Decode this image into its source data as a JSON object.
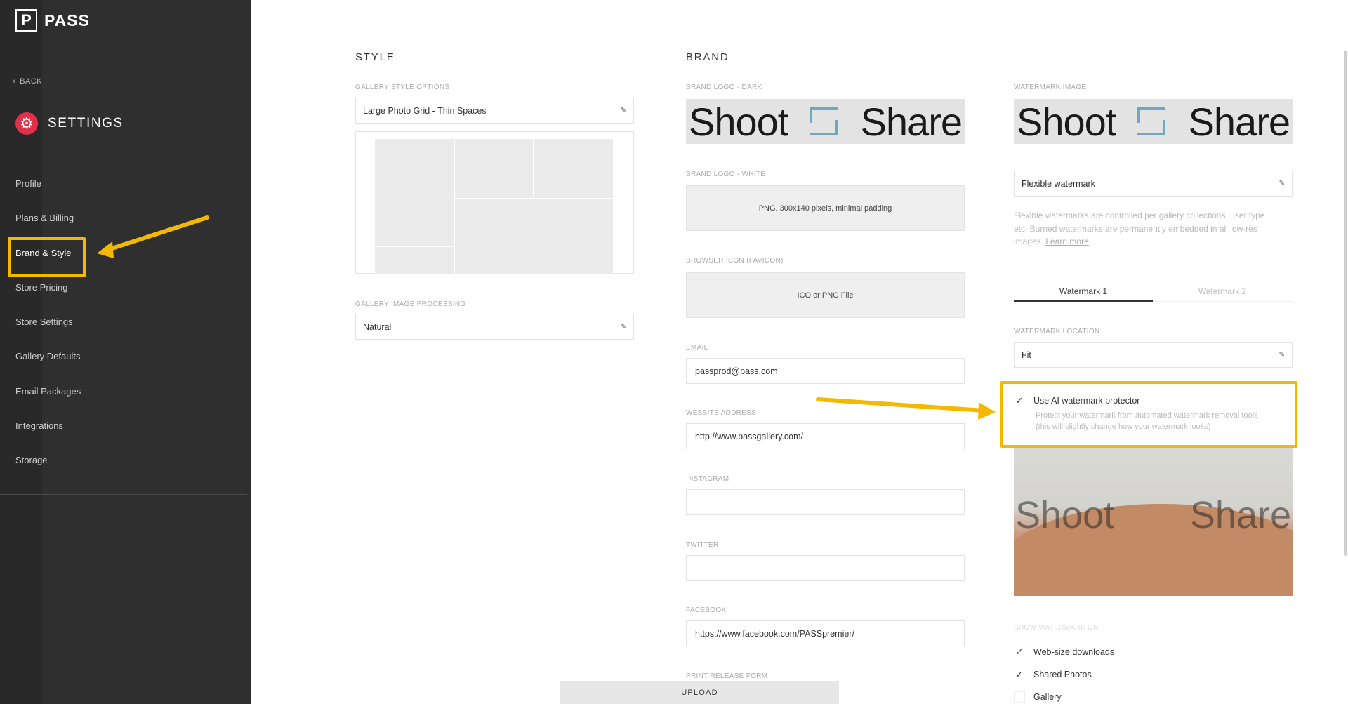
{
  "app": {
    "logo_letter": "P",
    "logo_word": "PASS"
  },
  "sidebar": {
    "back_label": "BACK",
    "title": "SETTINGS",
    "items": [
      {
        "label": "Profile"
      },
      {
        "label": "Plans & Billing"
      },
      {
        "label": "Brand & Style",
        "active": true
      },
      {
        "label": "Store Pricing"
      },
      {
        "label": "Store Settings"
      },
      {
        "label": "Gallery Defaults"
      },
      {
        "label": "Email Packages"
      },
      {
        "label": "Integrations"
      },
      {
        "label": "Storage"
      }
    ]
  },
  "style": {
    "title": "STYLE",
    "gallery_style_label": "GALLERY STYLE OPTIONS",
    "gallery_style_value": "Large Photo Grid - Thin Spaces",
    "image_processing_label": "GALLERY IMAGE PROCESSING",
    "image_processing_value": "Natural"
  },
  "brand": {
    "title": "BRAND",
    "logo_dark_label": "BRAND LOGO - DARK",
    "logo_word_left": "Shoot",
    "logo_word_right": "Share",
    "logo_white_label": "BRAND LOGO - WHITE",
    "logo_white_hint": "PNG, 300x140 pixels, minimal padding",
    "favicon_label": "BROWSER ICON (FAVICON)",
    "favicon_hint": "ICO or PNG File",
    "email_label": "EMAIL",
    "email_value": "passprod@pass.com",
    "website_label": "WEBSITE ADDRESS",
    "website_value": "http://www.passgallery.com/",
    "instagram_label": "INSTAGRAM",
    "instagram_value": "",
    "twitter_label": "TWITTER",
    "twitter_value": "",
    "facebook_label": "FACEBOOK",
    "facebook_value": "https://www.facebook.com/PASSpremier/",
    "print_release_label": "PRINT RELEASE FORM",
    "upload_label": "UPLOAD"
  },
  "watermark": {
    "image_label": "WATERMARK IMAGE",
    "type_value": "Flexible watermark",
    "desc_line1": "Flexible watermarks are controlled per gallery collections, user type",
    "desc_line2": "etc. Burned watermarks are permanently embedded in all low-res",
    "desc_line3": "images.",
    "learn_more": "Learn more",
    "tabs": [
      {
        "label": "Watermark 1",
        "active": true
      },
      {
        "label": "Watermark 2",
        "active": false
      }
    ],
    "location_label": "WATERMARK LOCATION",
    "location_value": "Fit",
    "ai_label": "Use AI watermark protector",
    "ai_checked": true,
    "ai_sub1": "Protect your watermark from automated watermark removal tools",
    "ai_sub2": "(this will slightly change how your watermark looks)",
    "show_on_label": "SHOW WATERMARK ON",
    "show_on": [
      {
        "label": "Web-size downloads",
        "checked": true
      },
      {
        "label": "Shared Photos",
        "checked": true
      },
      {
        "label": "Gallery",
        "checked": false
      }
    ]
  },
  "colors": {
    "sidebar_bg": "#2f2f2f",
    "accent_red": "#e0304a",
    "highlight_yellow": "#f5b800",
    "logo_blue": "#6fa7c0"
  }
}
